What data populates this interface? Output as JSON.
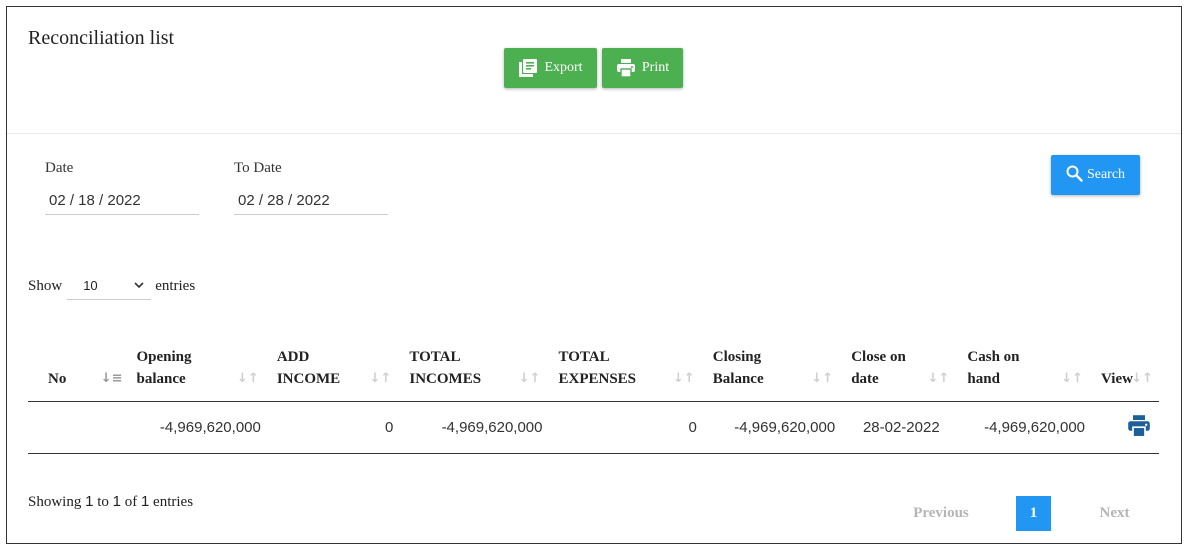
{
  "page": {
    "title": "Reconciliation list"
  },
  "toolbar": {
    "export_label": "Export",
    "print_label": "Print"
  },
  "filters": {
    "date_label": "Date",
    "date_value": "02 / 18 / 2022",
    "to_date_label": "To Date",
    "to_date_value": "02 / 28 / 2022",
    "search_label": "Search"
  },
  "length": {
    "show_label": "Show",
    "value": "10",
    "entries_label": "entries"
  },
  "table": {
    "headers": {
      "no": "No",
      "opening_balance": [
        "Opening",
        "balance"
      ],
      "add_income": [
        "ADD",
        "INCOME"
      ],
      "total_incomes": [
        "TOTAL",
        "INCOMES"
      ],
      "total_expenses": [
        "TOTAL",
        "EXPENSES"
      ],
      "closing_balance": [
        "Closing",
        "Balance"
      ],
      "close_on_date": [
        "Close on",
        "date"
      ],
      "cash_on_hand": [
        "Cash on",
        "hand"
      ],
      "view": "View"
    },
    "rows": [
      {
        "no": "",
        "opening_balance": "-4,969,620,000",
        "add_income": "0",
        "total_incomes": "-4,969,620,000",
        "total_expenses": "0",
        "closing_balance": "-4,969,620,000",
        "close_on_date": "28-02-2022",
        "cash_on_hand": "-4,969,620,000",
        "view_icon": "print-icon"
      }
    ]
  },
  "info": {
    "showing": "Showing",
    "from": "1",
    "to_word": "to",
    "to": "1",
    "of_word": "of",
    "total": "1",
    "entries": "entries"
  },
  "pagination": {
    "previous": "Previous",
    "current": "1",
    "next": "Next"
  },
  "colors": {
    "success": "#4caf50",
    "primary": "#2196f3",
    "icon_blue": "#1e5f99"
  }
}
